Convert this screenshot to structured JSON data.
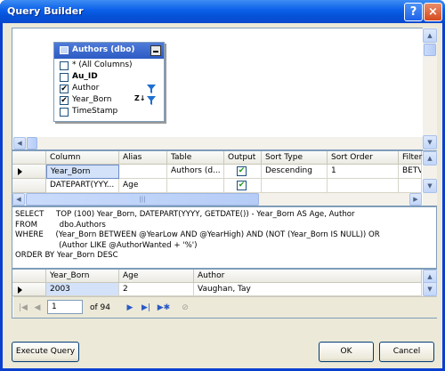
{
  "window": {
    "title": "Query Builder",
    "help_label": "?",
    "close_label": "×"
  },
  "diagram": {
    "table_name": "Authors (dbo)",
    "columns": [
      {
        "label": "* (All Columns)",
        "checked": false,
        "bold": false
      },
      {
        "label": "Au_ID",
        "checked": false,
        "bold": true
      },
      {
        "label": "Author",
        "checked": true,
        "bold": false
      },
      {
        "label": "Year_Born",
        "checked": true,
        "bold": false
      },
      {
        "label": "TimeStamp",
        "checked": false,
        "bold": false
      }
    ],
    "check_mark": "✔",
    "sort_glyph": "Z↓",
    "scroll_arrows": {
      "up": "▲",
      "down": "▼",
      "left": "◀",
      "right": "▶"
    }
  },
  "grid": {
    "headers": [
      "Column",
      "Alias",
      "Table",
      "Output",
      "Sort Type",
      "Sort Order",
      "Filter"
    ],
    "rows": [
      {
        "column": "Year_Born",
        "alias": "",
        "table": "Authors (d...",
        "output": true,
        "sort_type": "Descending",
        "sort_order": "1",
        "filter": "BETV"
      },
      {
        "column": "DATEPART(YYY...",
        "alias": "Age",
        "table": "",
        "output": true,
        "sort_type": "",
        "sort_order": "",
        "filter": ""
      }
    ],
    "thumb_glyph": "|||"
  },
  "sql": {
    "lines": [
      "SELECT     TOP (100) Year_Born, DATEPART(YYYY, GETDATE()) - Year_Born AS Age, Author",
      "FROM         dbo.Authors",
      "WHERE     (Year_Born BETWEEN @YearLow AND @YearHigh) AND (NOT (Year_Born IS NULL)) OR",
      "                  (Author LIKE @AuthorWanted + '%')",
      "ORDER BY Year_Born DESC"
    ]
  },
  "results": {
    "headers": [
      "Year_Born",
      "Age",
      "Author"
    ],
    "rows": [
      {
        "year_born": "2003",
        "age": "2",
        "author": "Vaughan, Tay"
      }
    ],
    "nav": {
      "first": "|◀",
      "prev": "◀",
      "page": "1",
      "of_label": "of 94",
      "next": "▶",
      "last": "▶|",
      "new": "▶✱",
      "stop": "⊘"
    }
  },
  "buttons": {
    "execute": "Execute Query",
    "ok": "OK",
    "cancel": "Cancel"
  }
}
